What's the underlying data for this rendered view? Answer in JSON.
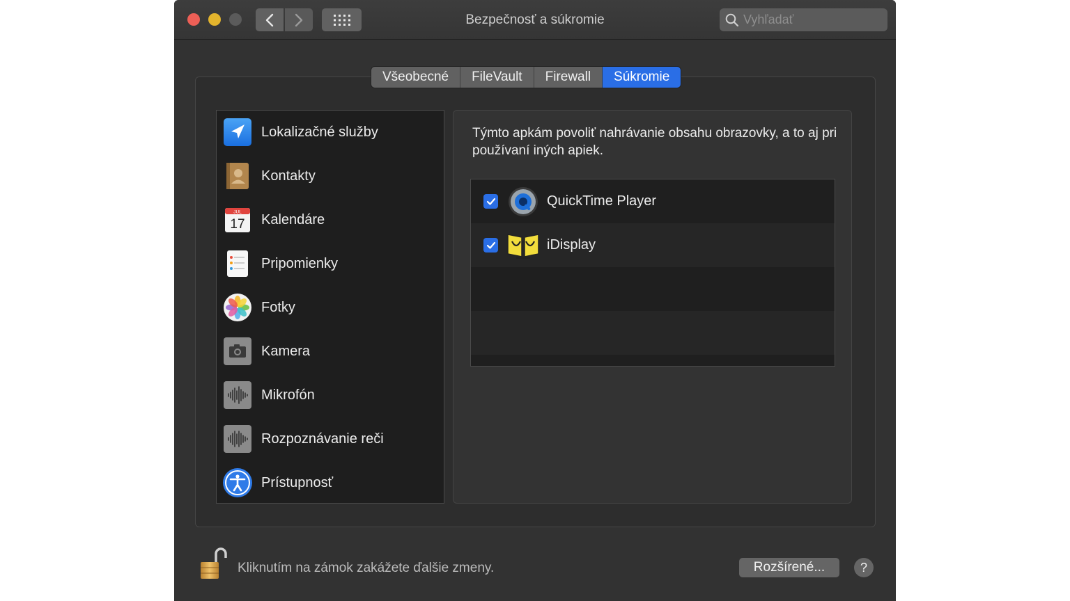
{
  "window": {
    "title": "Bezpečnosť a súkromie",
    "search_placeholder": "Vyhľadať"
  },
  "tabs": [
    {
      "label": "Všeobecné",
      "active": false
    },
    {
      "label": "FileVault",
      "active": false
    },
    {
      "label": "Firewall",
      "active": false
    },
    {
      "label": "Súkromie",
      "active": true
    }
  ],
  "sidebar": {
    "items": [
      {
        "label": "Lokalizačné služby",
        "icon": "location-arrow-icon"
      },
      {
        "label": "Kontakty",
        "icon": "contacts-book-icon"
      },
      {
        "label": "Kalendáre",
        "icon": "calendar-icon",
        "calendar_month": "JUL",
        "calendar_day": "17"
      },
      {
        "label": "Pripomienky",
        "icon": "reminders-list-icon"
      },
      {
        "label": "Fotky",
        "icon": "photos-flower-icon"
      },
      {
        "label": "Kamera",
        "icon": "camera-icon"
      },
      {
        "label": "Mikrofón",
        "icon": "microphone-waveform-icon"
      },
      {
        "label": "Rozpoznávanie reči",
        "icon": "speech-waveform-icon"
      },
      {
        "label": "Prístupnosť",
        "icon": "accessibility-person-icon"
      }
    ]
  },
  "main": {
    "description": "Týmto apkám povoliť nahrávanie obsahu obrazovky, a to aj pri používaní iných apiek.",
    "apps": [
      {
        "name": "QuickTime Player",
        "checked": true,
        "icon": "quicktime-icon"
      },
      {
        "name": "iDisplay",
        "checked": true,
        "icon": "idisplay-icon"
      }
    ]
  },
  "footer": {
    "lock_text": "Kliknutím na zámok zakážete ďalšie zmeny.",
    "advanced_label": "Rozšírené...",
    "help_label": "?"
  },
  "colors": {
    "accent": "#2a6ee6",
    "window_bg": "#323232",
    "sidebar_bg": "#1e1e1e"
  }
}
